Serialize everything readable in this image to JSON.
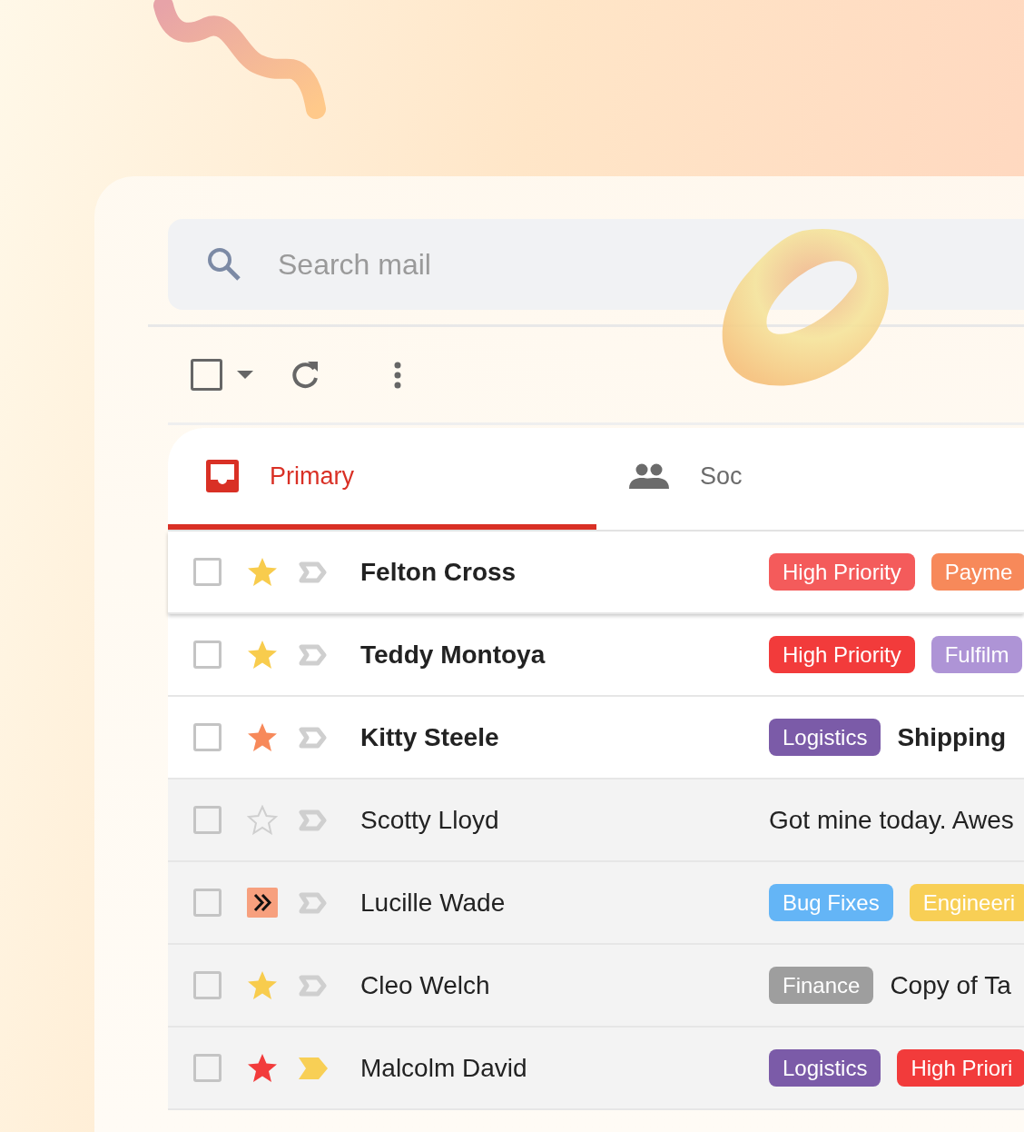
{
  "search": {
    "placeholder": "Search mail"
  },
  "toolbar": {
    "select_all_checked": false
  },
  "tabs": [
    {
      "label": "Primary",
      "kind": "inbox",
      "selected": true
    },
    {
      "label": "Soc",
      "kind": "people",
      "selected": false
    }
  ],
  "rows": [
    {
      "sender": "Felton Cross",
      "unread": true,
      "raised": true,
      "checked": false,
      "mark": {
        "kind": "star",
        "color": "#f8cc4d"
      },
      "important": false,
      "tags": [
        {
          "label": "High Priority",
          "color": "#f45b5b"
        },
        {
          "label": "Payme",
          "color": "#f7895a"
        }
      ]
    },
    {
      "sender": "Teddy Montoya",
      "unread": true,
      "raised": false,
      "checked": false,
      "mark": {
        "kind": "star",
        "color": "#f8cc4d"
      },
      "important": false,
      "tags": [
        {
          "label": "High Priority",
          "color": "#f23b3b"
        },
        {
          "label": "Fulfilm",
          "color": "#ae94d6"
        }
      ]
    },
    {
      "sender": "Kitty Steele",
      "unread": true,
      "raised": false,
      "checked": false,
      "mark": {
        "kind": "star",
        "color": "#f7895a"
      },
      "important": false,
      "tags": [
        {
          "label": "Logistics",
          "color": "#7b5ba8"
        }
      ],
      "snippet": "Shipping"
    },
    {
      "sender": "Scotty Lloyd",
      "unread": false,
      "raised": false,
      "checked": false,
      "mark": {
        "kind": "empty"
      },
      "important": false,
      "snippet": "Got mine today. Awes"
    },
    {
      "sender": "Lucille Wade",
      "unread": false,
      "raised": false,
      "checked": false,
      "mark": {
        "kind": "forward",
        "color": "#f7a07e"
      },
      "important": false,
      "tags": [
        {
          "label": "Bug Fixes",
          "color": "#64b5f6"
        },
        {
          "label": "Engineeri",
          "color": "#f8cf55"
        }
      ]
    },
    {
      "sender": "Cleo Welch",
      "unread": false,
      "raised": false,
      "checked": false,
      "mark": {
        "kind": "star",
        "color": "#f8cc4d"
      },
      "important": false,
      "tags": [
        {
          "label": "Finance",
          "color": "#9e9e9e"
        }
      ],
      "snippet": "Copy of Ta"
    },
    {
      "sender": "Malcolm David",
      "unread": false,
      "raised": false,
      "checked": false,
      "mark": {
        "kind": "star",
        "color": "#f23b3b"
      },
      "important": true,
      "tags": [
        {
          "label": "Logistics",
          "color": "#7b5ba8"
        },
        {
          "label": "High Priori",
          "color": "#f23b3b"
        }
      ]
    }
  ]
}
